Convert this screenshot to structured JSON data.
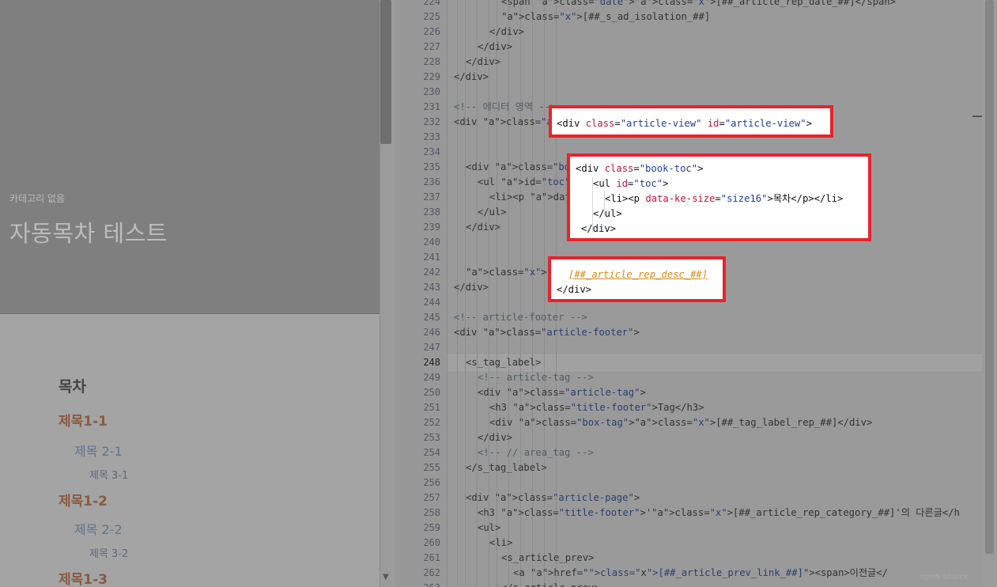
{
  "preview": {
    "category": "카테고리 없음",
    "title": "자동목차 테스트",
    "toc_heading": "목차",
    "toc_items": [
      {
        "level": 1,
        "label": "제목1-1"
      },
      {
        "level": 2,
        "label": "제목 2-1"
      },
      {
        "level": 3,
        "label": "제목 3-1"
      },
      {
        "level": 1,
        "label": "제목1-2"
      },
      {
        "level": 2,
        "label": "제목 2-2"
      },
      {
        "level": 3,
        "label": "제목 3-2"
      },
      {
        "level": 1,
        "label": "제목1-3"
      }
    ]
  },
  "editor": {
    "first_line": 224,
    "last_line": 263,
    "current_line": 248,
    "lines": [
      "<span class=\"date\">[##_article_rep_date_##]</span>",
      "[##_s_ad_isolation_##]",
      "</div>",
      "</div>",
      "</div>",
      "</div>",
      "",
      "<!-- 에디터 영역 -->",
      "<div class=\"article-view\" id=\"article-view\">",
      "",
      "",
      "<div class=\"book-toc\">",
      "<ul id=\"toc\">",
      "<li><p data-ke-size=\"size16\">목차</p></li>",
      "</ul>",
      "</div>",
      "",
      "",
      "[##_article_rep_desc_##]",
      "</div>",
      "",
      "<!-- article-footer -->",
      "<div class=\"article-footer\">",
      "",
      "<s_tag_label>",
      "<!-- article-tag -->",
      "<div class=\"article-tag\">",
      "<h3 class=\"title-footer\">Tag</h3>",
      "<div class=\"box-tag\">[##_tag_label_rep_##]</div>",
      "</div>",
      "<!-- // area_tag -->",
      "</s_tag_label>",
      "",
      "<div class=\"article-page\">",
      "<h3 class=\"title-footer\">'[##_article_rep_category_##]'의 다른글</h",
      "<ul>",
      "<li>",
      "<s_article_prev>",
      "<a href=\"[##_article_prev_link_##]\"><span>이전글</",
      "</s_article_prev>"
    ],
    "watermark": "open source"
  },
  "colors": {
    "highlight_border": "#e8232a",
    "highlight_bg": "#ffffff",
    "toc_level1": "#8a5a43",
    "toc_level2": "#5e7590"
  }
}
